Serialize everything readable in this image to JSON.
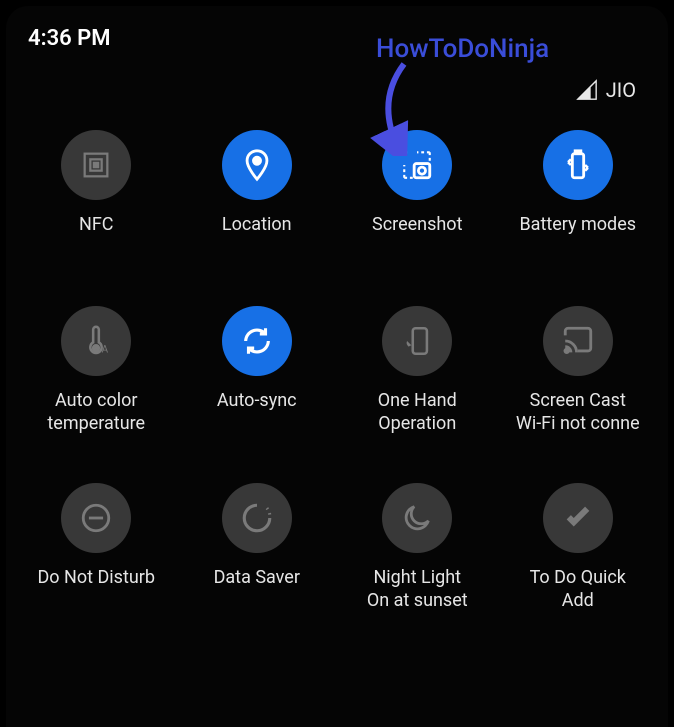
{
  "status": {
    "time": "4:36 PM",
    "carrier": "JIO"
  },
  "watermark": "HowToDoNinja",
  "tiles": {
    "nfc": {
      "label": "NFC"
    },
    "location": {
      "label": "Location"
    },
    "screenshot": {
      "label": "Screenshot"
    },
    "battery": {
      "label": "Battery modes"
    },
    "autocolor": {
      "label": "Auto color\ntemperature"
    },
    "autosync": {
      "label": "Auto-sync"
    },
    "onehand": {
      "label": "One Hand\nOperation"
    },
    "screencast": {
      "label": "Screen Cast\nWi-Fi not conne"
    },
    "dnd": {
      "label": "Do Not Disturb"
    },
    "datasaver": {
      "label": "Data Saver"
    },
    "nightlight": {
      "label": "Night Light\nOn at sunset"
    },
    "todo": {
      "label": "To Do Quick\nAdd"
    }
  }
}
